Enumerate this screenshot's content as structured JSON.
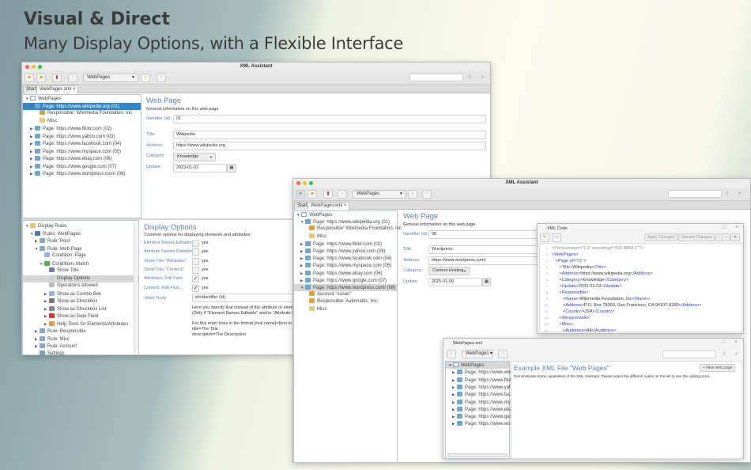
{
  "header": {
    "title": "Visual & Direct",
    "subtitle": "Many Display Options, with a Flexible Interface"
  },
  "colors": {
    "accent": "#2f86c8",
    "label": "#5a7fb7"
  },
  "window1": {
    "title": "XML Assistant",
    "combo": "WebPages",
    "tabs": [
      "Start",
      "WebPages.xml ×"
    ],
    "tree": [
      {
        "t": "WebPages",
        "l": 0,
        "tw": "▼",
        "ic": "doc"
      },
      {
        "t": "Page: https://www.wikipedia.org (01)",
        "l": 1,
        "tw": "▼",
        "ic": "page",
        "sel": true
      },
      {
        "t": "Responsible: Wikimedia Foundation, Inc",
        "l": 2,
        "ic": "person"
      },
      {
        "t": "Misc",
        "l": 2,
        "ic": "search"
      },
      {
        "t": "Page: https://www.flickr.com (02)",
        "l": 1,
        "tw": "▶",
        "ic": "page"
      },
      {
        "t": "Page: https://www.yahoo.com (03)",
        "l": 1,
        "tw": "▶",
        "ic": "page"
      },
      {
        "t": "Page: https://www.facebook.com (04)",
        "l": 1,
        "tw": "▶",
        "ic": "page"
      },
      {
        "t": "Page: https://www.myspace.com (05)",
        "l": 1,
        "tw": "▶",
        "ic": "page"
      },
      {
        "t": "Page: https://www.ebay.com (06)",
        "l": 1,
        "tw": "▶",
        "ic": "page"
      },
      {
        "t": "Page: https://www.google.com (07)",
        "l": 1,
        "tw": "▶",
        "ic": "page"
      },
      {
        "t": "Page: https://www.wordpress.com/ (08)",
        "l": 1,
        "tw": "▶",
        "ic": "page"
      }
    ],
    "form": {
      "title": "Web Page",
      "description": "General information on this web page",
      "identifier_label": "Identifier (id):",
      "identifier": "01",
      "title_label": "Title:",
      "title_value": "Wikipedia",
      "address_label": "Address:",
      "address": "https://www.wikipedia.org",
      "category_label": "Category:",
      "category": "Knowledge",
      "update_label": "Update:",
      "update": "2023-01-02"
    },
    "rules_tree": [
      {
        "t": "Display Rules",
        "l": 0,
        "tw": "▼",
        "ic": "folder"
      },
      {
        "t": "Rules: WebPages",
        "l": 1,
        "tw": "▼",
        "ic": "book"
      },
      {
        "t": "Rule: Root",
        "l": 2,
        "tw": "▶",
        "ic": "rule"
      },
      {
        "t": "Rule: Web Page",
        "l": 2,
        "tw": "▼",
        "ic": "rule"
      },
      {
        "t": "Condition: Page",
        "l": 3,
        "ic": "cond"
      },
      {
        "t": "Conditions Match",
        "l": 3,
        "tw": "▼",
        "ic": "ok"
      },
      {
        "t": "Show Title",
        "l": 4,
        "ic": "text"
      },
      {
        "t": "Display Options",
        "l": 4,
        "ic": "opts",
        "gsel": true
      },
      {
        "t": "Operations Allowed",
        "l": 4,
        "ic": "lock"
      },
      {
        "t": "Show as Combo Box",
        "l": 4,
        "tw": "▶",
        "ic": "combo"
      },
      {
        "t": "Show as Checkbox",
        "l": 4,
        "tw": "▶",
        "ic": "check"
      },
      {
        "t": "Show as Checkbox List",
        "l": 4,
        "tw": "▶",
        "ic": "list"
      },
      {
        "t": "Show as Date Field",
        "l": 4,
        "tw": "▶",
        "ic": "date"
      },
      {
        "t": "Help Texts for Elements/Attributes",
        "l": 4,
        "tw": "▶",
        "ic": "help"
      },
      {
        "t": "Rule: Responsible",
        "l": 2,
        "tw": "▶",
        "ic": "rule"
      },
      {
        "t": "Rule: Misc",
        "l": 2,
        "tw": "▶",
        "ic": "rule"
      },
      {
        "t": "Rule: Account",
        "l": 2,
        "tw": "▶",
        "ic": "rule"
      },
      {
        "t": "Settings",
        "l": 2,
        "ic": "settings"
      }
    ],
    "display_options": {
      "title": "Display Options",
      "description": "Common options for displaying elements and attributes",
      "rows": [
        {
          "label": "Element Names Editable:",
          "checked": false,
          "text": "yes"
        },
        {
          "label": "Attribute Names Editable:",
          "checked": false,
          "text": "yes"
        },
        {
          "label": "Show Title \"Attributes\":",
          "checked": false,
          "text": "yes"
        },
        {
          "label": "Show Title \"Content\":",
          "checked": false,
          "text": "yes"
        },
        {
          "label": "Attributes: Edit Fast:",
          "checked": true,
          "text": "yes"
        },
        {
          "label": "Content: Edit Fast:",
          "checked": true,
          "text": "yes"
        }
      ],
      "other_label": "Other Texts:",
      "other_value": "id=Identifier (id)",
      "help": [
        "Here you specify that instead of the attribute or eleme",
        "(Only if \"Element Names Editable\" and/or \"Attribute N",
        "",
        "For this enter lines in the format [real name]=[text to d",
        "title=The Title",
        "description=The Description"
      ]
    }
  },
  "window2": {
    "title": "XML Assistant",
    "combo": "WebPages",
    "tabs": [
      "Start",
      "WebPages.xml ×"
    ],
    "tree": [
      {
        "t": "WebPages",
        "l": 0,
        "tw": "▼",
        "ic": "doc"
      },
      {
        "t": "Page: https://www.wikipedia.org (01)",
        "l": 1,
        "tw": "▼",
        "ic": "page"
      },
      {
        "t": "Responsible: Wikimedia Foundation, Inc",
        "l": 2,
        "ic": "person"
      },
      {
        "t": "Misc",
        "l": 2,
        "ic": "search"
      },
      {
        "t": "Page: https://www.flickr.com (02)",
        "l": 1,
        "tw": "▶",
        "ic": "page"
      },
      {
        "t": "Page: https://www.yahoo.com (03)",
        "l": 1,
        "tw": "▶",
        "ic": "page"
      },
      {
        "t": "Page: https://www.facebook.com (04)",
        "l": 1,
        "tw": "▶",
        "ic": "page"
      },
      {
        "t": "Page: https://www.myspace.com (05)",
        "l": 1,
        "tw": "▶",
        "ic": "page"
      },
      {
        "t": "Page: https://www.ebay.com (06)",
        "l": 1,
        "tw": "▶",
        "ic": "page"
      },
      {
        "t": "Page: https://www.google.com (07)",
        "l": 1,
        "tw": "▶",
        "ic": "page"
      },
      {
        "t": "Page: https://www.wordpress.com/ (08)",
        "l": 1,
        "tw": "▼",
        "ic": "page",
        "gsel": true
      },
      {
        "t": "Account \"susan\"",
        "l": 2,
        "ic": "key"
      },
      {
        "t": "Responsible: Automattic, Inc.",
        "l": 2,
        "ic": "person"
      },
      {
        "t": "Misc",
        "l": 2,
        "ic": "search"
      }
    ],
    "form": {
      "title": "Web Page",
      "description": "General information on this web page",
      "identifier_label": "Identifier (id):",
      "identifier": "08",
      "title_label": "Title:",
      "title_value": "Wordpress",
      "address_label": "Address:",
      "address": "https://www.wordpress.com/",
      "category_label": "Category:",
      "category": "Content Hosting",
      "update_label": "Update:",
      "update": "2025-01-06"
    }
  },
  "xml_code": {
    "title": "XML Code",
    "apply": "Apply Changes",
    "discard": "Discard Changes",
    "lines": [
      [
        [
          "pi",
          "<?xml version=\"1.0\" encoding=\"ISO-8859-1\"?>"
        ]
      ],
      [
        [
          "tag",
          "<WebPages>"
        ]
      ],
      [
        [
          "tag",
          "   <Page id="
        ],
        [
          "val",
          "\"01\""
        ],
        [
          "tag",
          ">"
        ]
      ],
      [
        [
          "tag",
          "      <Title>"
        ],
        [
          "t",
          "Wikipedia"
        ],
        [
          "tag",
          "</Title>"
        ]
      ],
      [
        [
          "tag",
          "      <Address>"
        ],
        [
          "t",
          "https://www.wikipedia.org"
        ],
        [
          "tag",
          "</Address>"
        ]
      ],
      [
        [
          "tag",
          "      <Category>"
        ],
        [
          "t",
          "Knowledge"
        ],
        [
          "tag",
          "</Category>"
        ]
      ],
      [
        [
          "tag",
          "      <Update>"
        ],
        [
          "t",
          "2023-01-02"
        ],
        [
          "tag",
          "</Update>"
        ]
      ],
      [
        [
          "tag",
          "      <Responsible>"
        ]
      ],
      [
        [
          "tag",
          "         <Name>"
        ],
        [
          "t",
          "Wikimedia Foundation, Inc"
        ],
        [
          "tag",
          "</Name>"
        ]
      ],
      [
        [
          "tag",
          "         <Address>"
        ],
        [
          "t",
          "P.O. Box 78350, San Francisco, CA 94107-8350"
        ],
        [
          "tag",
          "</Address>"
        ]
      ],
      [
        [
          "tag",
          "         <Country>"
        ],
        [
          "t",
          "USA"
        ],
        [
          "tag",
          "</Country>"
        ]
      ],
      [
        [
          "tag",
          "      </Responsible>"
        ]
      ],
      [
        [
          "tag",
          "      <Misc>"
        ]
      ],
      [
        [
          "tag",
          "         <Audience>"
        ],
        [
          "t",
          "All"
        ],
        [
          "tag",
          "</Audience>"
        ]
      ]
    ]
  },
  "small_window": {
    "title": "WebPages.xml",
    "combo": "WebPages ▾",
    "heading": "Example XML File \"Web Pages\"",
    "new_button": "+ New web page",
    "description": "Demonstrates some capabilities of the XML Assistant. Please select the different nodes on the left to see the editing possi...",
    "tree": [
      {
        "t": "WebPages",
        "l": 0,
        "tw": "▼",
        "ic": "doc",
        "gsel": true
      },
      {
        "t": "Page: https://www.wikipe",
        "l": 1,
        "tw": "▶",
        "ic": "page"
      },
      {
        "t": "Page: https://www.flickr.c",
        "l": 1,
        "tw": "▶",
        "ic": "page"
      },
      {
        "t": "Page: https://www.yahoo",
        "l": 1,
        "tw": "▶",
        "ic": "page"
      },
      {
        "t": "Page: https://www.faceb",
        "l": 1,
        "tw": "▶",
        "ic": "page"
      },
      {
        "t": "Page: https://www.mysp",
        "l": 1,
        "tw": "▶",
        "ic": "page"
      },
      {
        "t": "Page: https://www.ebay.",
        "l": 1,
        "tw": "▶",
        "ic": "page"
      },
      {
        "t": "Page: https://www.googl",
        "l": 1,
        "tw": "▶",
        "ic": "page"
      },
      {
        "t": "Page: https://www.wordp",
        "l": 1,
        "tw": "▶",
        "ic": "page"
      }
    ]
  }
}
